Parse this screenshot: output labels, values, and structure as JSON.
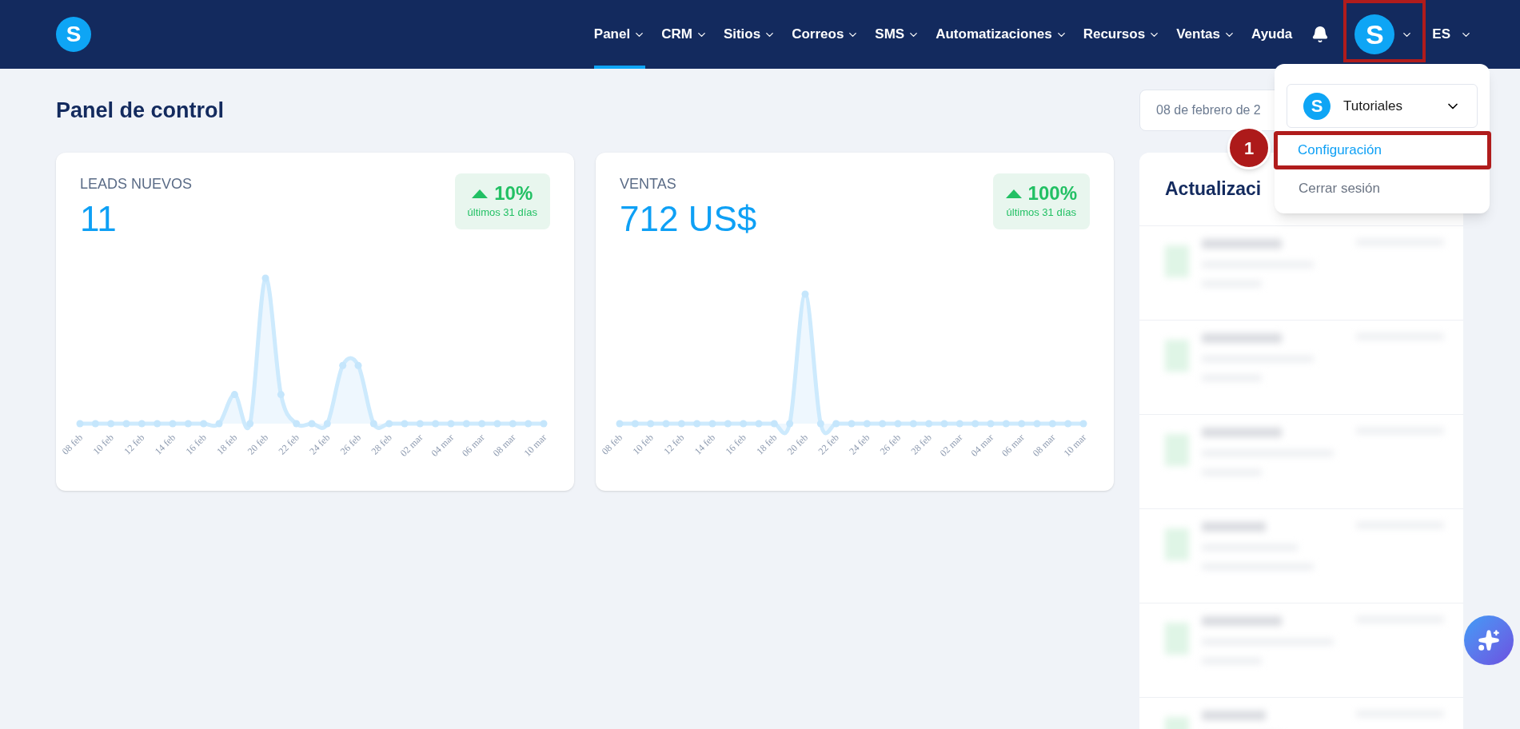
{
  "nav": {
    "items": [
      {
        "label": "Panel",
        "selected": true,
        "has_menu": true
      },
      {
        "label": "CRM",
        "selected": false,
        "has_menu": true
      },
      {
        "label": "Sitios",
        "selected": false,
        "has_menu": true
      },
      {
        "label": "Correos",
        "selected": false,
        "has_menu": true
      },
      {
        "label": "SMS",
        "selected": false,
        "has_menu": true
      },
      {
        "label": "Automatizaciones",
        "selected": false,
        "has_menu": true
      },
      {
        "label": "Recursos",
        "selected": false,
        "has_menu": true
      },
      {
        "label": "Ventas",
        "selected": false,
        "has_menu": true
      },
      {
        "label": "Ayuda",
        "selected": false,
        "has_menu": false
      }
    ],
    "avatar_letter": "S",
    "language": "ES",
    "logo_letter": "S"
  },
  "page_title": "Panel de control",
  "date_range": "08 de febrero de 2",
  "cards": [
    {
      "title": "LEADS NUEVOS",
      "value": "11",
      "change": "10%",
      "period": "últimos 31 días",
      "x_labels": [
        "08 feb",
        "10 feb",
        "12 feb",
        "14 feb",
        "16 feb",
        "18 feb",
        "20 feb",
        "22 feb",
        "24 feb",
        "26 feb",
        "28 feb",
        "02 mar",
        "04 mar",
        "06 mar",
        "08 mar",
        "10 mar"
      ]
    },
    {
      "title": "VENTAS",
      "value": "712 US$",
      "change": "100%",
      "period": "últimos 31 días",
      "x_labels": [
        "08 feb",
        "10 feb",
        "12 feb",
        "14 feb",
        "16 feb",
        "18 feb",
        "20 feb",
        "22 feb",
        "24 feb",
        "26 feb",
        "28 feb",
        "02 mar",
        "04 mar",
        "06 mar",
        "08 mar",
        "10 mar"
      ]
    }
  ],
  "updates_panel": {
    "title": "Actualizaci"
  },
  "account_menu": {
    "account": {
      "letter": "S",
      "name": "Tutoriales"
    },
    "items": [
      {
        "label": "Configuración",
        "selected": true
      },
      {
        "label": "Cerrar sesión",
        "selected": false
      }
    ]
  },
  "callout": {
    "number": "1"
  }
}
